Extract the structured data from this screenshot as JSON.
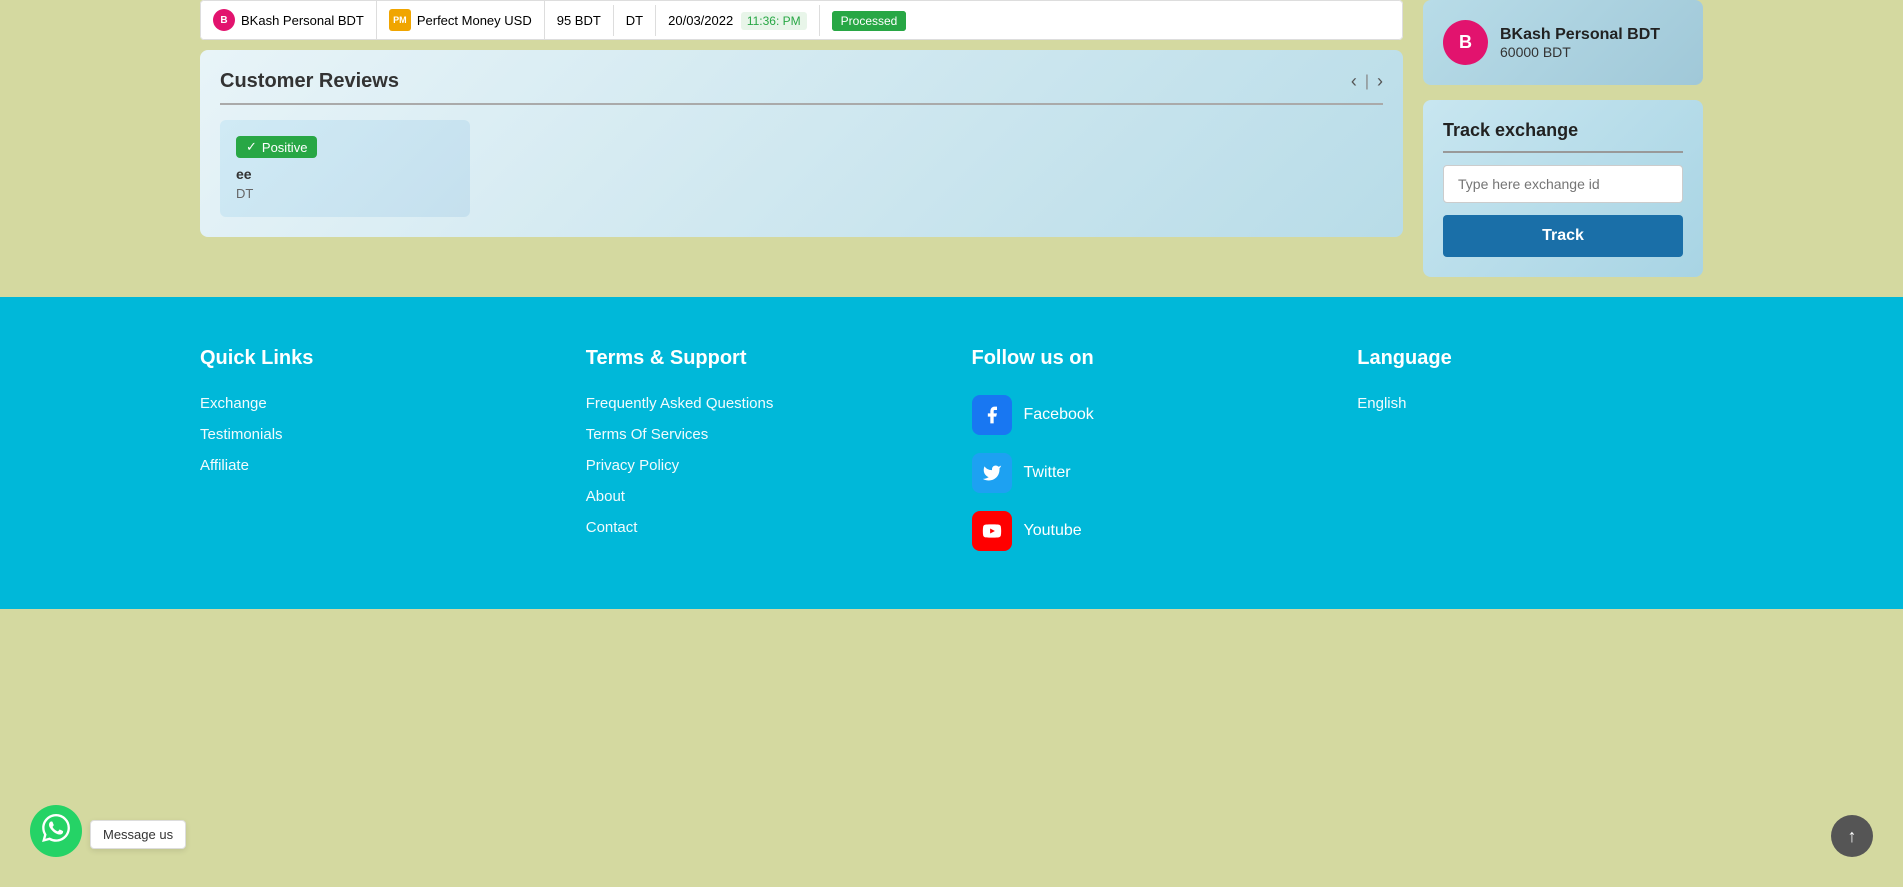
{
  "transaction": {
    "from": "BKash Personal BDT",
    "to": "Perfect Money USD",
    "amount": "95 BDT",
    "type": "DT",
    "date": "20/03/2022",
    "time": "11:36: PM",
    "status": "Processed"
  },
  "sidebar": {
    "bkash": {
      "name": "BKash Personal BDT",
      "amount": "60000 BDT"
    },
    "track": {
      "title": "Track exchange",
      "input_placeholder": "Type here exchange id",
      "button_label": "Track"
    }
  },
  "reviews": {
    "title": "Customer Reviews",
    "items": [
      {
        "sentiment": "Positive",
        "user": "ee",
        "type": "DT"
      }
    ]
  },
  "footer": {
    "quick_links": {
      "heading": "Quick Links",
      "items": [
        {
          "label": "Exchange",
          "href": "#"
        },
        {
          "label": "Testimonials",
          "href": "#"
        },
        {
          "label": "Affiliate",
          "href": "#"
        }
      ]
    },
    "terms_support": {
      "heading": "Terms & Support",
      "items": [
        {
          "label": "Frequently Asked Questions",
          "href": "#"
        },
        {
          "label": "Terms Of Services",
          "href": "#"
        },
        {
          "label": "Privacy Policy",
          "href": "#"
        },
        {
          "label": "About",
          "href": "#"
        },
        {
          "label": "Contact",
          "href": "#"
        }
      ]
    },
    "follow_us": {
      "heading": "Follow us on",
      "items": [
        {
          "label": "Facebook",
          "icon": "facebook-icon"
        },
        {
          "label": "Twitter",
          "icon": "twitter-icon"
        },
        {
          "label": "Youtube",
          "icon": "youtube-icon"
        }
      ]
    },
    "language": {
      "heading": "Language",
      "items": [
        {
          "label": "English"
        }
      ]
    }
  },
  "whatsapp": {
    "message_us": "Message us"
  },
  "icons": {
    "positive_check": "✓",
    "facebook": "f",
    "twitter": "t",
    "youtube": "▶",
    "whatsapp": "💬",
    "arrow_up": "↑",
    "nav_prev": "‹",
    "nav_sep": "|",
    "nav_next": "›"
  }
}
